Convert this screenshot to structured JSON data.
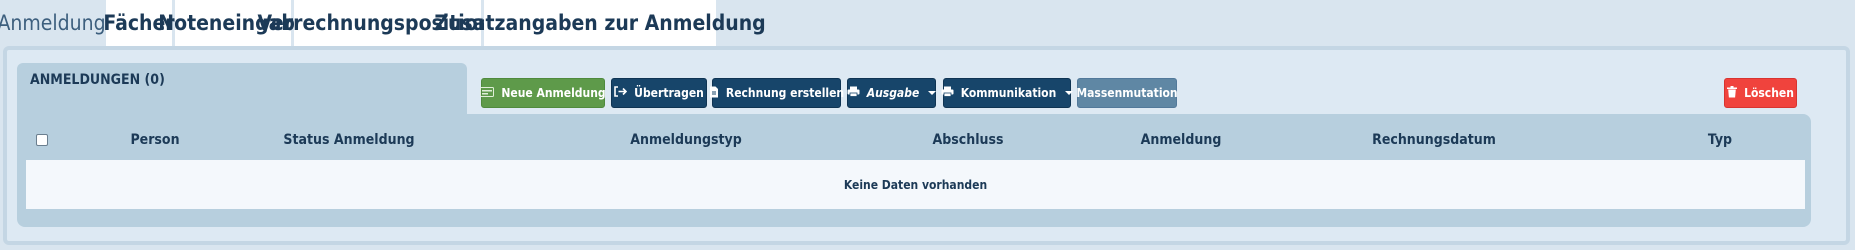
{
  "tabs": [
    {
      "label": "Anmeldung",
      "active": true
    },
    {
      "label": "Fächer"
    },
    {
      "label": "Noteneingabe"
    },
    {
      "label": "Verrechnungspositionen"
    },
    {
      "label": "Zusatzangaben zur Anmeldung"
    }
  ],
  "panel": {
    "title": "ANMELDUNGEN (0)"
  },
  "toolbar": {
    "new_label": "Neue Anmeldung",
    "transfer_label": "Übertragen",
    "invoice_label": "Rechnung erstellen",
    "output_label": "Ausgabe",
    "communication_label": "Kommunikation",
    "mass_label": "Massenmutation",
    "delete_label": "Löschen"
  },
  "table": {
    "columns": [
      "Person",
      "Status Anmeldung",
      "Anmeldungstyp",
      "Abschluss",
      "Anmeldung",
      "Rechnungsdatum",
      "Typ"
    ],
    "empty_text": "Keine Daten vorhanden"
  },
  "colors": {
    "active_tab_bg": "#d9e5ef",
    "dark_button": "#17456a",
    "green_button": "#5e9a4a",
    "muted_button": "#5f87a4",
    "delete_button": "#f0433d"
  }
}
